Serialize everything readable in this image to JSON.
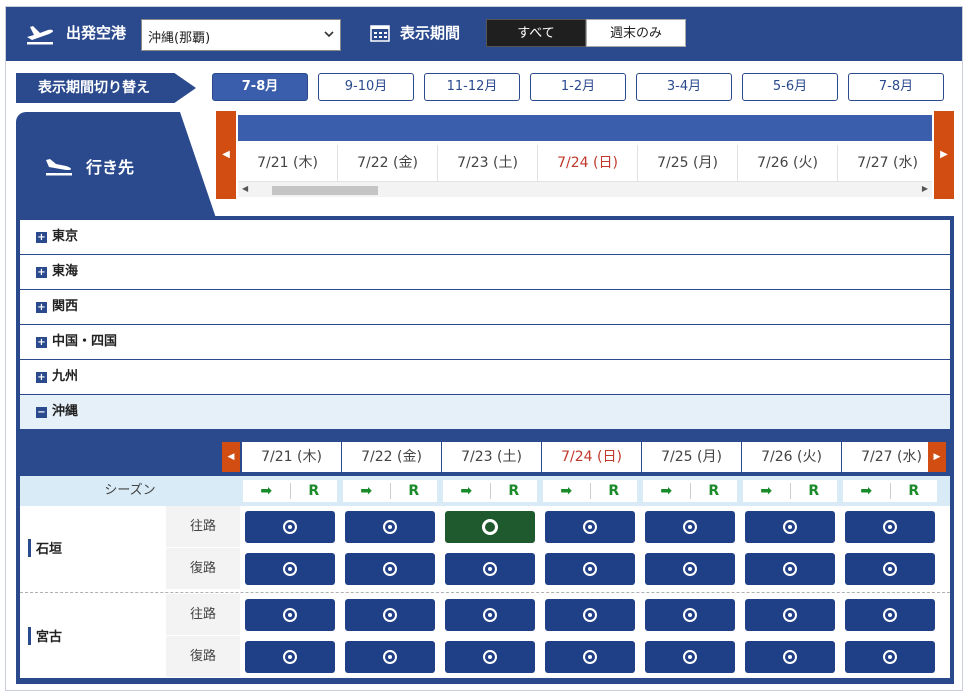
{
  "header": {
    "departure_label": "出発空港",
    "airport_value": "沖縄(那覇)",
    "period_label": "表示期間",
    "segments": [
      {
        "label": "すべて",
        "selected": true
      },
      {
        "label": "週末のみ",
        "selected": false
      }
    ]
  },
  "period_switch": {
    "label": "表示期間切り替え",
    "tabs": [
      "7-8月",
      "9-10月",
      "11-12月",
      "1-2月",
      "3-4月",
      "5-6月",
      "7-8月"
    ],
    "active_index": 0
  },
  "destination": {
    "label": "行き先"
  },
  "dates": [
    {
      "label": "7/21 (木)",
      "sunday": false
    },
    {
      "label": "7/22 (金)",
      "sunday": false
    },
    {
      "label": "7/23 (土)",
      "sunday": false
    },
    {
      "label": "7/24 (日)",
      "sunday": true
    },
    {
      "label": "7/25 (月)",
      "sunday": false
    },
    {
      "label": "7/26 (火)",
      "sunday": false
    },
    {
      "label": "7/27 (水)",
      "sunday": false
    }
  ],
  "regions": [
    {
      "name": "東京",
      "expanded": false
    },
    {
      "name": "東海",
      "expanded": false
    },
    {
      "name": "関西",
      "expanded": false
    },
    {
      "name": "中国・四国",
      "expanded": false
    },
    {
      "name": "九州",
      "expanded": false
    },
    {
      "name": "沖縄",
      "expanded": true
    }
  ],
  "season": {
    "label": "シーズン",
    "arrow": "➡",
    "r": "R"
  },
  "routes": [
    {
      "name": "石垣",
      "legs": [
        {
          "label": "往路",
          "flights": [
            "normal",
            "normal",
            "selected",
            "normal",
            "normal",
            "normal",
            "normal"
          ]
        },
        {
          "label": "復路",
          "flights": [
            "normal",
            "normal",
            "normal",
            "normal",
            "normal",
            "normal",
            "normal"
          ]
        }
      ]
    },
    {
      "name": "宮古",
      "legs": [
        {
          "label": "往路",
          "flights": [
            "normal",
            "normal",
            "normal",
            "normal",
            "normal",
            "normal",
            "normal"
          ]
        },
        {
          "label": "復路",
          "flights": [
            "normal",
            "normal",
            "normal",
            "normal",
            "normal",
            "normal",
            "normal"
          ]
        }
      ]
    }
  ],
  "colors": {
    "navy": "#2b4a8e",
    "orange": "#d24d12",
    "button": "#1f3f86",
    "selected_button": "#1e5a2d",
    "sunday": "#c0392b",
    "season_green": "#1a8a2a"
  },
  "icons": {
    "departure": "airplane-takeoff-icon",
    "arrival": "airplane-landing-icon",
    "calendar": "calendar-icon"
  }
}
